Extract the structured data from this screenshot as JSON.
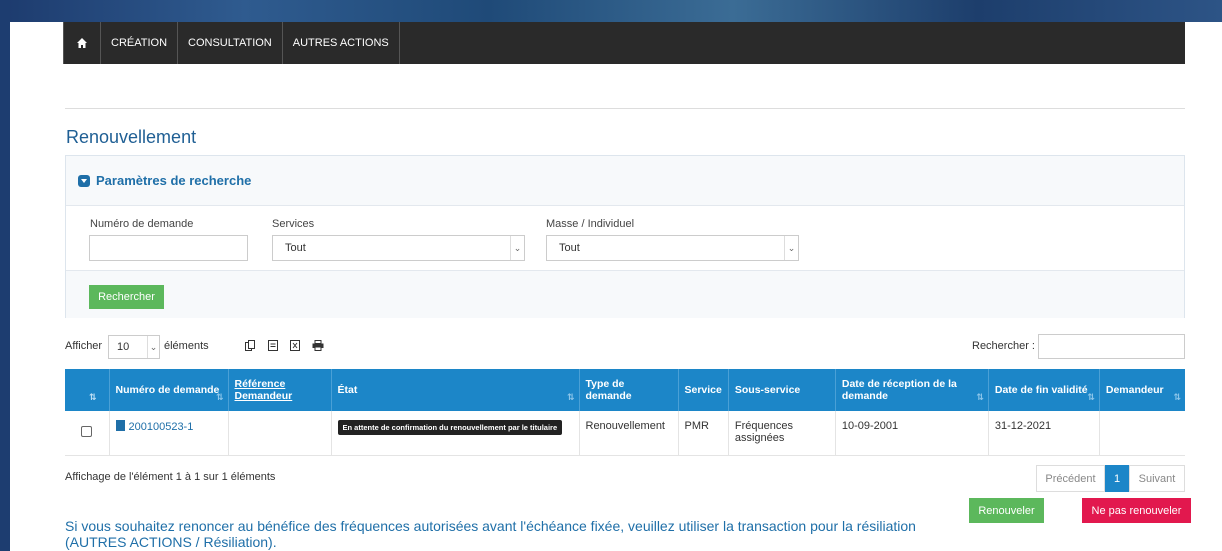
{
  "nav": {
    "home_icon": "home-icon",
    "items": [
      "CRÉATION",
      "CONSULTATION",
      "AUTRES ACTIONS"
    ]
  },
  "page": {
    "title": "Renouvellement"
  },
  "search_panel": {
    "title": "Paramètres de recherche",
    "fields": {
      "numero_label": "Numéro de demande",
      "numero_value": "",
      "services_label": "Services",
      "services_value": "Tout",
      "masse_label": "Masse / Individuel",
      "masse_value": "Tout"
    },
    "search_button": "Rechercher"
  },
  "table_controls": {
    "show_label": "Afficher",
    "length_value": "10",
    "entries_label": "éléments",
    "export_icons": [
      "copy-icon",
      "csv-icon",
      "excel-icon",
      "print-icon"
    ],
    "search_label": "Rechercher :",
    "search_value": ""
  },
  "table": {
    "columns": [
      "Numéro de demande",
      "Référence Demandeur",
      "État",
      "Type de demande",
      "Service",
      "Sous-service",
      "Date de réception de la demande",
      "Date de fin validité",
      "Demandeur"
    ],
    "rows": [
      {
        "numero": "200100523-1",
        "reference": "",
        "etat": "En attente de confirmation du renouvellement par le titulaire",
        "type": "Renouvellement",
        "service": "PMR",
        "sous_service": "Fréquences assignées",
        "date_reception": "10-09-2001",
        "date_fin": "31-12-2021",
        "demandeur": ""
      }
    ]
  },
  "pagination": {
    "info": "Affichage de l'élément 1 à 1 sur 1 éléments",
    "previous": "Précédent",
    "current": "1",
    "next": "Suivant"
  },
  "actions": {
    "renew": "Renouveler",
    "not_renew": "Ne pas renouveler"
  },
  "notice": "Si vous souhaitez renoncer au bénéfice des fréquences autorisées avant l'échéance fixée, veuillez utiliser la transaction pour la résiliation (AUTRES ACTIONS / Résiliation).",
  "colors": {
    "navbar": "#2a2a2a",
    "accent": "#1f6fa8",
    "table_header": "#1c86c8",
    "success": "#5cb85c",
    "danger": "#e2184e"
  }
}
